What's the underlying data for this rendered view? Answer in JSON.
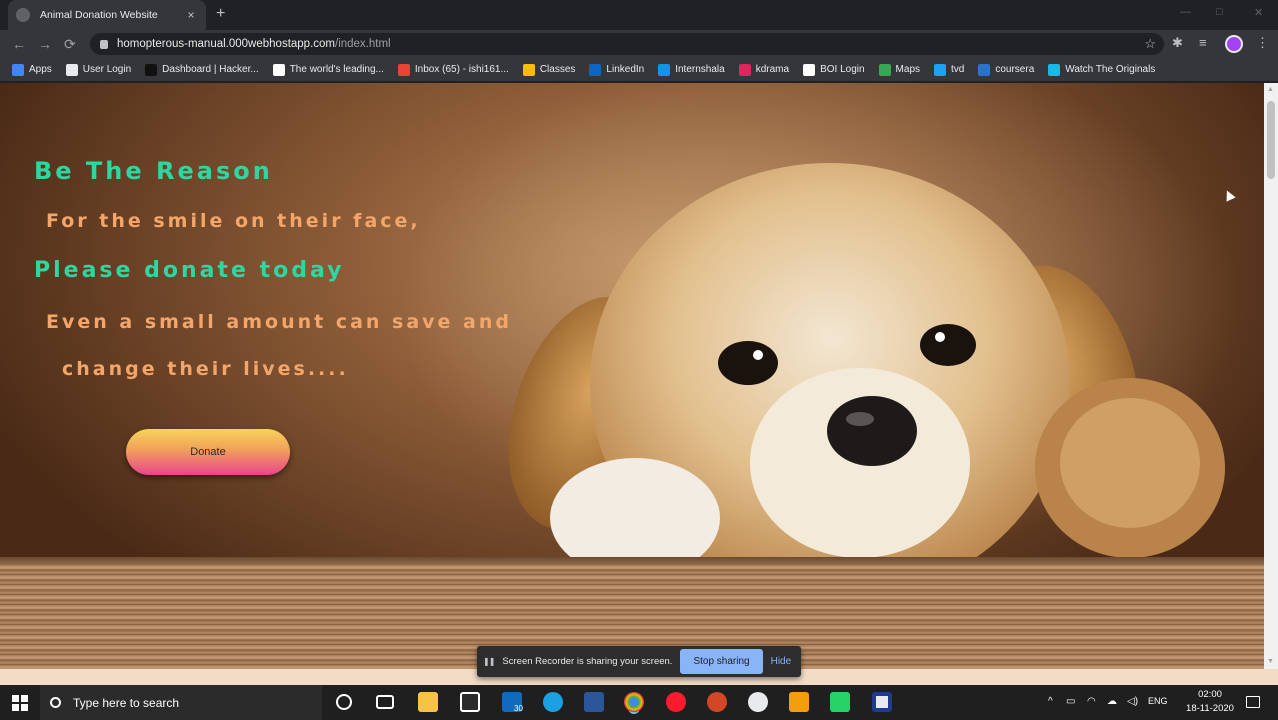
{
  "browser": {
    "tab_title": "Animal Donation Website",
    "tab_close": "×",
    "new_tab": "+",
    "url_host": "homopterous-manual.000webhostapp.com",
    "url_path": "/index.html",
    "bookmarks": [
      {
        "label": "Apps",
        "color": "#4285f4"
      },
      {
        "label": "User Login",
        "color": "#e8eaed"
      },
      {
        "label": "Dashboard | Hacker...",
        "color": "#111111"
      },
      {
        "label": "The world's leading...",
        "color": "#ffffff"
      },
      {
        "label": "Inbox (65) - ishi161...",
        "color": "#ea4335"
      },
      {
        "label": "Classes",
        "color": "#fbbc04"
      },
      {
        "label": "LinkedIn",
        "color": "#0a66c2"
      },
      {
        "label": "Internshala",
        "color": "#1295e8"
      },
      {
        "label": "kdrama",
        "color": "#e0245e"
      },
      {
        "label": "BOI Login",
        "color": "#ffffff"
      },
      {
        "label": "Maps",
        "color": "#34a853"
      },
      {
        "label": "tvd",
        "color": "#1da1f2"
      },
      {
        "label": "coursera",
        "color": "#2a73cc"
      },
      {
        "label": "Watch The Originals",
        "color": "#1ab7ea"
      }
    ]
  },
  "hero": {
    "line1": "Be The Reason",
    "line2": "For the smile on their face,",
    "line3": "Please donate today",
    "line4": "Even a small amount can save and",
    "line5": "change their lives....",
    "donate_label": "Donate"
  },
  "sharebar": {
    "message": "Screen Recorder is sharing your screen.",
    "stop_label": "Stop sharing",
    "hide_label": "Hide"
  },
  "taskbar": {
    "search_placeholder": "Type here to search",
    "mail_badge": "30",
    "language": "ENG",
    "time": "02:00",
    "date": "18-11-2020"
  },
  "colors": {
    "accent_green": "#2fd6a0",
    "accent_orange": "#f4a66a",
    "stop_button": "#8ab4f8"
  }
}
